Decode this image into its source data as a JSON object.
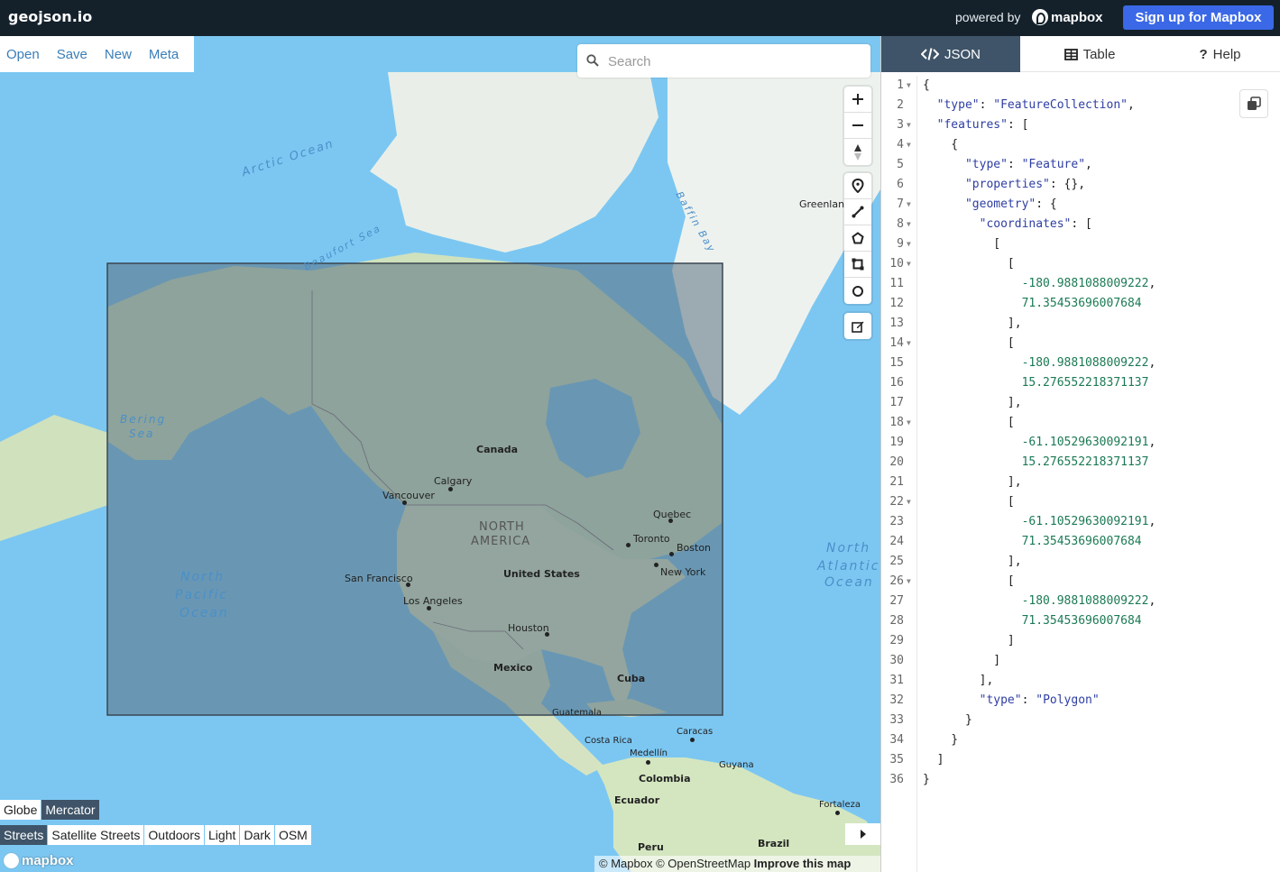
{
  "app": {
    "title": "geojson.io",
    "powered_by": "powered by",
    "brand": "mapbox",
    "signup_label": "Sign up for Mapbox"
  },
  "file_menu": [
    {
      "label": "Open"
    },
    {
      "label": "Save"
    },
    {
      "label": "New"
    },
    {
      "label": "Meta"
    }
  ],
  "search": {
    "placeholder": "Search",
    "value": ""
  },
  "map_controls": {
    "zoom": [
      "plus-icon",
      "minus-icon",
      "compass-icon"
    ],
    "draw": [
      "marker-icon",
      "line-icon",
      "polygon-icon",
      "rectangle-icon",
      "circle-icon"
    ],
    "edit": [
      "edit-icon"
    ]
  },
  "map_labels": {
    "arctic_ocean": "Arctic Ocean",
    "beaufort_sea": "Beaufort Sea",
    "baffin_bay": "Baffin Bay",
    "greenland": "Greenland",
    "bering_sea_1": "Bering",
    "bering_sea_2": "Sea",
    "canada": "Canada",
    "calgary": "Calgary",
    "vancouver": "Vancouver",
    "north_america_1": "NORTH",
    "north_america_2": "AMERICA",
    "quebec": "Quebec",
    "toronto": "Toronto",
    "boston": "Boston",
    "new_york": "New York",
    "united_states": "United States",
    "san_francisco": "San Francisco",
    "los_angeles": "Los Angeles",
    "north_pacific_1": "North",
    "north_pacific_2": "Pacific",
    "north_pacific_3": "Ocean",
    "houston": "Houston",
    "mexico": "Mexico",
    "cuba": "Cuba",
    "guatemala": "Guatemala",
    "caracas": "Caracas",
    "costa_rica": "Costa Rica",
    "medellin": "Medellín",
    "colombia": "Colombia",
    "guyana": "Guyana",
    "ecuador": "Ecuador",
    "fortaleza": "Fortaleza",
    "peru": "Peru",
    "brazil": "Brazil",
    "north_atlantic_1": "North",
    "north_atlantic_2": "Atlantic",
    "north_atlantic_3": "Ocean"
  },
  "projection": [
    {
      "label": "Globe",
      "active": false
    },
    {
      "label": "Mercator",
      "active": true
    }
  ],
  "styles": [
    {
      "label": "Streets",
      "active": true
    },
    {
      "label": "Satellite Streets",
      "active": false
    },
    {
      "label": "Outdoors",
      "active": false
    },
    {
      "label": "Light",
      "active": false
    },
    {
      "label": "Dark",
      "active": false
    },
    {
      "label": "OSM",
      "active": false
    }
  ],
  "attribution": {
    "mapbox": "© Mapbox",
    "osm": "© OpenStreetMap",
    "improve": "Improve this map"
  },
  "mapbox_logo": "mapbox",
  "panel": {
    "tabs": [
      {
        "label": "JSON",
        "icon": "code-icon",
        "active": true
      },
      {
        "label": "Table",
        "icon": "table-icon",
        "active": false
      },
      {
        "label": "Help",
        "icon": "question-icon",
        "active": false
      }
    ]
  },
  "code_lines": [
    {
      "n": "1",
      "fold": true,
      "html": "{"
    },
    {
      "n": "2",
      "fold": false,
      "html": "  <span class='k'>\"type\"</span>: <span class='s'>\"FeatureCollection\"</span>,"
    },
    {
      "n": "3",
      "fold": true,
      "html": "  <span class='k'>\"features\"</span>: ["
    },
    {
      "n": "4",
      "fold": true,
      "html": "    {"
    },
    {
      "n": "5",
      "fold": false,
      "html": "      <span class='k'>\"type\"</span>: <span class='s'>\"Feature\"</span>,"
    },
    {
      "n": "6",
      "fold": false,
      "html": "      <span class='k'>\"properties\"</span>: {},"
    },
    {
      "n": "7",
      "fold": true,
      "html": "      <span class='k'>\"geometry\"</span>: {"
    },
    {
      "n": "8",
      "fold": true,
      "html": "        <span class='k'>\"coordinates\"</span>: ["
    },
    {
      "n": "9",
      "fold": true,
      "html": "          ["
    },
    {
      "n": "10",
      "fold": true,
      "html": "            ["
    },
    {
      "n": "11",
      "fold": false,
      "html": "              <span class='n'>-180.9881088009222</span>,"
    },
    {
      "n": "12",
      "fold": false,
      "html": "              <span class='n'>71.35453696007684</span>"
    },
    {
      "n": "13",
      "fold": false,
      "html": "            ],"
    },
    {
      "n": "14",
      "fold": true,
      "html": "            ["
    },
    {
      "n": "15",
      "fold": false,
      "html": "              <span class='n'>-180.9881088009222</span>,"
    },
    {
      "n": "16",
      "fold": false,
      "html": "              <span class='n'>15.276552218371137</span>"
    },
    {
      "n": "17",
      "fold": false,
      "html": "            ],"
    },
    {
      "n": "18",
      "fold": true,
      "html": "            ["
    },
    {
      "n": "19",
      "fold": false,
      "html": "              <span class='n'>-61.10529630092191</span>,"
    },
    {
      "n": "20",
      "fold": false,
      "html": "              <span class='n'>15.276552218371137</span>"
    },
    {
      "n": "21",
      "fold": false,
      "html": "            ],"
    },
    {
      "n": "22",
      "fold": true,
      "html": "            ["
    },
    {
      "n": "23",
      "fold": false,
      "html": "              <span class='n'>-61.10529630092191</span>,"
    },
    {
      "n": "24",
      "fold": false,
      "html": "              <span class='n'>71.35453696007684</span>"
    },
    {
      "n": "25",
      "fold": false,
      "html": "            ],"
    },
    {
      "n": "26",
      "fold": true,
      "html": "            ["
    },
    {
      "n": "27",
      "fold": false,
      "html": "              <span class='n'>-180.9881088009222</span>,"
    },
    {
      "n": "28",
      "fold": false,
      "html": "              <span class='n'>71.35453696007684</span>"
    },
    {
      "n": "29",
      "fold": false,
      "html": "            ]"
    },
    {
      "n": "30",
      "fold": false,
      "html": "          ]"
    },
    {
      "n": "31",
      "fold": false,
      "html": "        ],"
    },
    {
      "n": "32",
      "fold": false,
      "html": "        <span class='k'>\"type\"</span>: <span class='s'>\"Polygon\"</span>"
    },
    {
      "n": "33",
      "fold": false,
      "html": "      }"
    },
    {
      "n": "34",
      "fold": false,
      "html": "    }"
    },
    {
      "n": "35",
      "fold": false,
      "html": "  ]"
    },
    {
      "n": "36",
      "fold": false,
      "html": "}"
    }
  ],
  "colors": {
    "topbar": "#14212b",
    "signup": "#3a68e6",
    "ocean": "#79c4f0",
    "land": "#cfe8c0",
    "selection_fill": "#6a7f8a",
    "active_tab": "#3f5468"
  }
}
